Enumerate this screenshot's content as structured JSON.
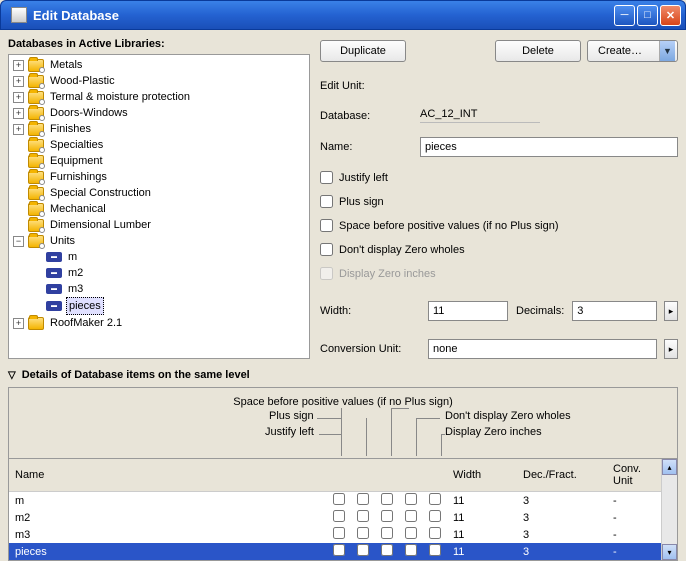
{
  "window": {
    "title": "Edit Database"
  },
  "tree_header": "Databases in Active Libraries:",
  "tree": {
    "items": [
      {
        "label": "Metals",
        "exp": "+",
        "key": true
      },
      {
        "label": "Wood-Plastic",
        "exp": "+",
        "key": true
      },
      {
        "label": "Termal & moisture protection",
        "exp": "+",
        "key": true
      },
      {
        "label": "Doors-Windows",
        "exp": "+",
        "key": true
      },
      {
        "label": "Finishes",
        "exp": "+",
        "key": true
      },
      {
        "label": "Specialties",
        "key": true
      },
      {
        "label": "Equipment",
        "key": true
      },
      {
        "label": "Furnishings",
        "key": true
      },
      {
        "label": "Special Construction",
        "key": true
      },
      {
        "label": "Mechanical",
        "key": true
      },
      {
        "label": "Dimensional Lumber",
        "key": true
      }
    ],
    "units_label": "Units",
    "units": [
      "m",
      "m2",
      "m3",
      "pieces"
    ],
    "selected_unit": "pieces",
    "last_label": "RoofMaker 2.1"
  },
  "buttons": {
    "duplicate": "Duplicate",
    "delete": "Delete",
    "create": "Create…"
  },
  "edit_unit": {
    "section": "Edit Unit:",
    "db_label": "Database:",
    "db_value": "AC_12_INT",
    "name_label": "Name:",
    "name_value": "pieces",
    "checks": {
      "justify": "Justify left",
      "plus": "Plus sign",
      "space": "Space before positive values (if no Plus sign)",
      "zero": "Don't display Zero wholes",
      "inches": "Display Zero inches"
    },
    "width_label": "Width:",
    "width_value": "11",
    "dec_label": "Decimals:",
    "dec_value": "3",
    "conv_label": "Conversion Unit:",
    "conv_value": "none"
  },
  "details_header": "Details of Database items on the same level",
  "col_labels": {
    "space": "Space before positive values (if no Plus sign)",
    "plus": "Plus sign",
    "zero": "Don't display Zero wholes",
    "justify": "Justify left",
    "inches": "Display Zero inches",
    "name": "Name",
    "width": "Width",
    "dec": "Dec./Fract.",
    "conv": "Conv. Unit"
  },
  "rows": [
    {
      "name": "m",
      "width": "11",
      "dec": "3",
      "conv": "-"
    },
    {
      "name": "m2",
      "width": "11",
      "dec": "3",
      "conv": "-"
    },
    {
      "name": "m3",
      "width": "11",
      "dec": "3",
      "conv": "-"
    },
    {
      "name": "pieces",
      "width": "11",
      "dec": "3",
      "conv": "-",
      "selected": true
    }
  ]
}
